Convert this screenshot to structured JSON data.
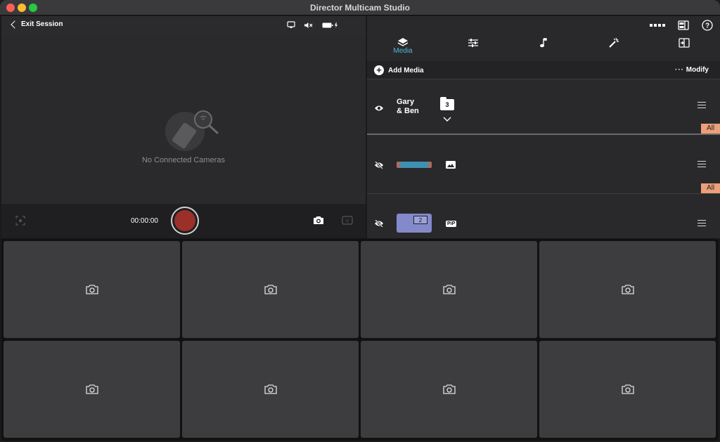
{
  "app": {
    "title": "Director Multicam Studio"
  },
  "preview": {
    "exit_label": "Exit Session",
    "empty_message": "No Connected Cameras",
    "timecode": "00:00:00"
  },
  "tabs": [
    {
      "label": "Media",
      "icon": "layers-icon",
      "active": true
    },
    {
      "label": "",
      "icon": "sliders-icon"
    },
    {
      "label": "",
      "icon": "music-note-icon"
    },
    {
      "label": "",
      "icon": "magic-wand-icon"
    },
    {
      "label": "",
      "icon": "enter-icon"
    }
  ],
  "media": {
    "add_label": "Add Media",
    "modify_label": "Modify",
    "rows": [
      {
        "name_line1": "Gary",
        "name_line2": "& Ben",
        "count": "3",
        "badge": "All",
        "visible": true
      },
      {
        "badge": "All",
        "visible": false
      },
      {
        "pip_number": "2",
        "pip_label": "PiP",
        "visible": false
      }
    ]
  },
  "cameras": [
    {
      "slot": 1
    },
    {
      "slot": 2
    },
    {
      "slot": 3
    },
    {
      "slot": 4
    },
    {
      "slot": 5
    },
    {
      "slot": 6
    },
    {
      "slot": 7
    },
    {
      "slot": 8
    }
  ],
  "colors": {
    "accent": "#4fb8d8",
    "record": "#9b2f2a",
    "badge": "#ec9f79",
    "pip": "#8489c9"
  }
}
